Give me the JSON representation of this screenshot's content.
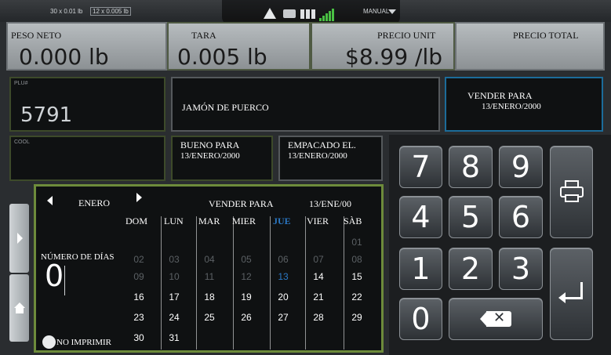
{
  "topbar": {
    "scale_1": "30 x 0.01 lb",
    "scale_2": "12 x 0.005 lb",
    "mode": "MANUAL"
  },
  "weights": {
    "net_label": "PESO NETO",
    "net_value": "0.000 lb",
    "tare_label": "TARA",
    "tare_value": "0.005 lb",
    "unit_price_label": "PRECIO UNIT",
    "unit_price_value": "$8.99 /lb",
    "total_label": "PRECIO TOTAL"
  },
  "plu": {
    "caption": "PLU#",
    "value": "5791"
  },
  "product": {
    "name": "JAMÓN DE PUERCO"
  },
  "sell_by": {
    "label": "VENDER PARA",
    "date": "13/ENERO/2000"
  },
  "cool": {
    "caption": "COOL"
  },
  "best_by": {
    "label": "BUENO PARA",
    "date": "13/ENERO/2000"
  },
  "packed": {
    "label": "EMPACADO EL.",
    "date": "13/ENERO/2000"
  },
  "calendar": {
    "month": "ENERO",
    "title": "VENDER PARA",
    "short_date": "13/ENE/00",
    "days_label": "NÚMERO DE DÍAS",
    "days_value": "0",
    "no_print": "NO IMPRIMIR",
    "weekdays": [
      "DOM",
      "LUN",
      "MAR",
      "MIER",
      "JUE",
      "VIER",
      "SÀB"
    ],
    "weeks": [
      [
        "",
        "",
        "",
        "",
        "",
        "",
        "01"
      ],
      [
        "02",
        "03",
        "04",
        "05",
        "06",
        "07",
        "08"
      ],
      [
        "09",
        "10",
        "11",
        "12",
        "13",
        "14",
        "15"
      ],
      [
        "16",
        "17",
        "18",
        "19",
        "20",
        "21",
        "22"
      ],
      [
        "23",
        "24",
        "25",
        "26",
        "27",
        "28",
        "29"
      ],
      [
        "30",
        "31",
        "",
        "",
        "",
        "",
        ""
      ]
    ],
    "selected_day": "13"
  },
  "keypad": {
    "digits": [
      "7",
      "8",
      "9",
      "4",
      "5",
      "6",
      "1",
      "2",
      "3",
      "0"
    ]
  },
  "colors": {
    "accent_green": "#6d8b3b",
    "accent_blue": "#1c6c9a",
    "selected_day": "#2b78c4",
    "signal": "#49c043"
  }
}
